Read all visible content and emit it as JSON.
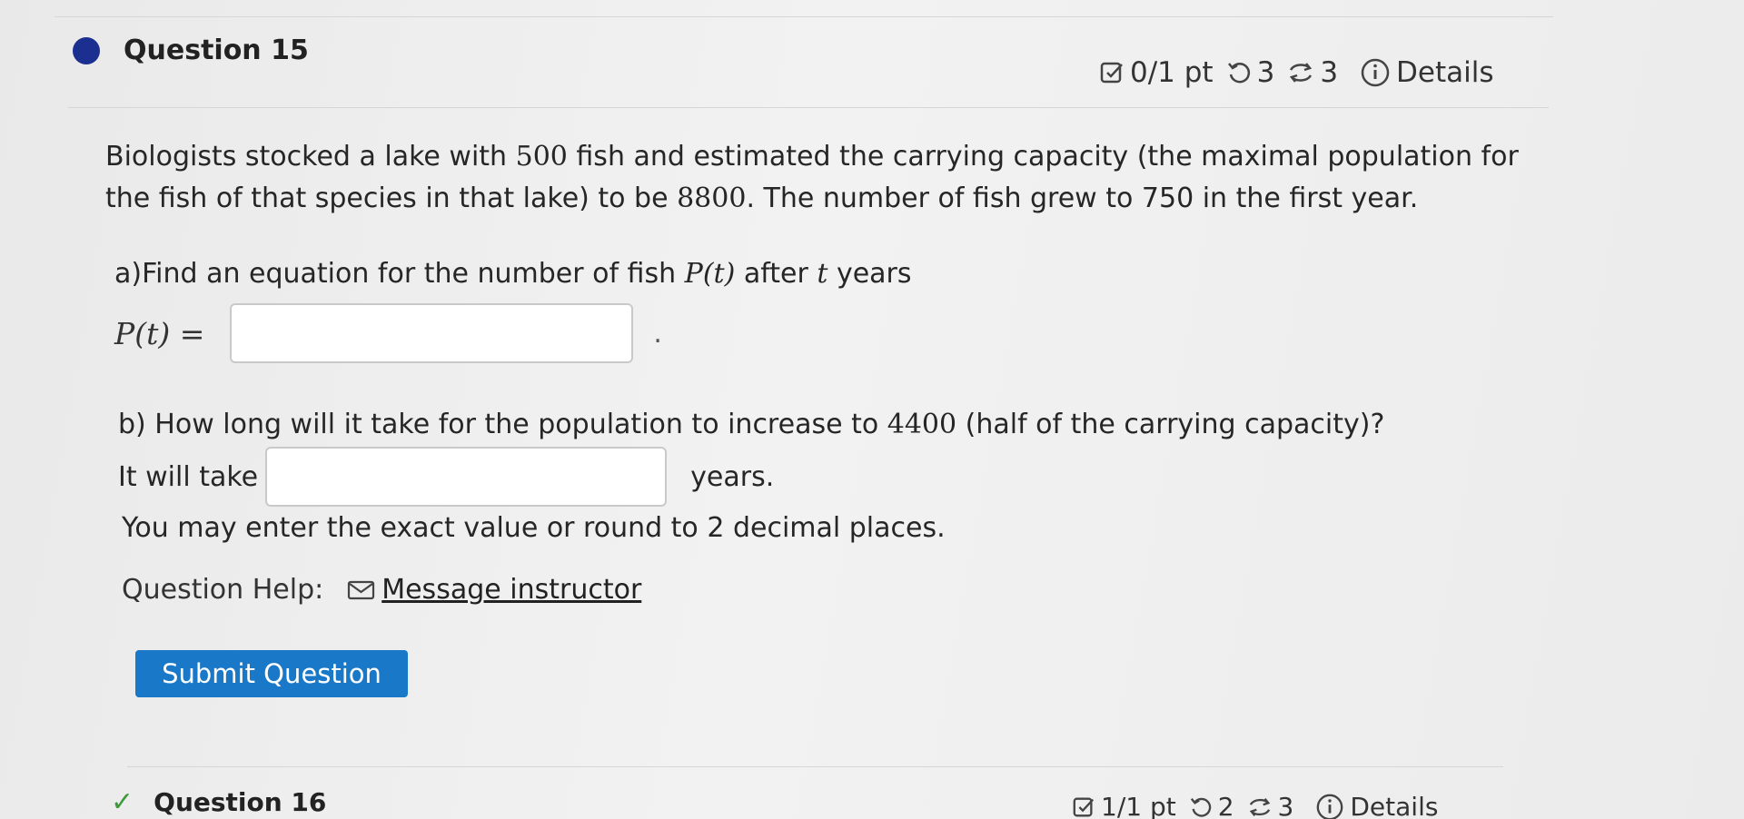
{
  "question": {
    "title": "Question 15",
    "score": "0/1 pt",
    "retries": "3",
    "attempts": "3",
    "details_label": "Details"
  },
  "problem": {
    "intro_1": "Biologists stocked a lake with ",
    "initial": "500",
    "intro_2": " fish and estimated the carrying capacity (the maximal population for the fish of that species in that lake) to be ",
    "capacity": "8800",
    "intro_3": ". The number of fish grew to 750 in the first year."
  },
  "part_a": {
    "prompt_1": "a)Find an equation for the number of fish ",
    "func": "P(t)",
    "prompt_2": " after ",
    "var": "t",
    "prompt_3": " years",
    "eq_label": "P(t) =",
    "value": "",
    "trailing": "."
  },
  "part_b": {
    "prompt_1": "b) How long will it take for the population to increase to ",
    "target": "4400",
    "prompt_2": " (half of the carrying capacity)?",
    "prefix": "It will take",
    "value": "",
    "suffix": "years.",
    "hint": "You may enter the exact value or round to 2 decimal places."
  },
  "help": {
    "label": "Question Help:",
    "message_label": "Message instructor"
  },
  "submit_label": "Submit Question",
  "next_question": {
    "title": "Question 16",
    "check": "✓",
    "score": "1/1 pt",
    "retries": "2",
    "attempts": "3",
    "details_label": "Details"
  },
  "colors": {
    "accent": "#1a78c8",
    "status_dot": "#1a2f8f",
    "correct": "#3f9a3c"
  },
  "icons": [
    "score-icon",
    "retry-icon",
    "attempts-icon",
    "info-icon",
    "mail-icon",
    "check-icon"
  ]
}
